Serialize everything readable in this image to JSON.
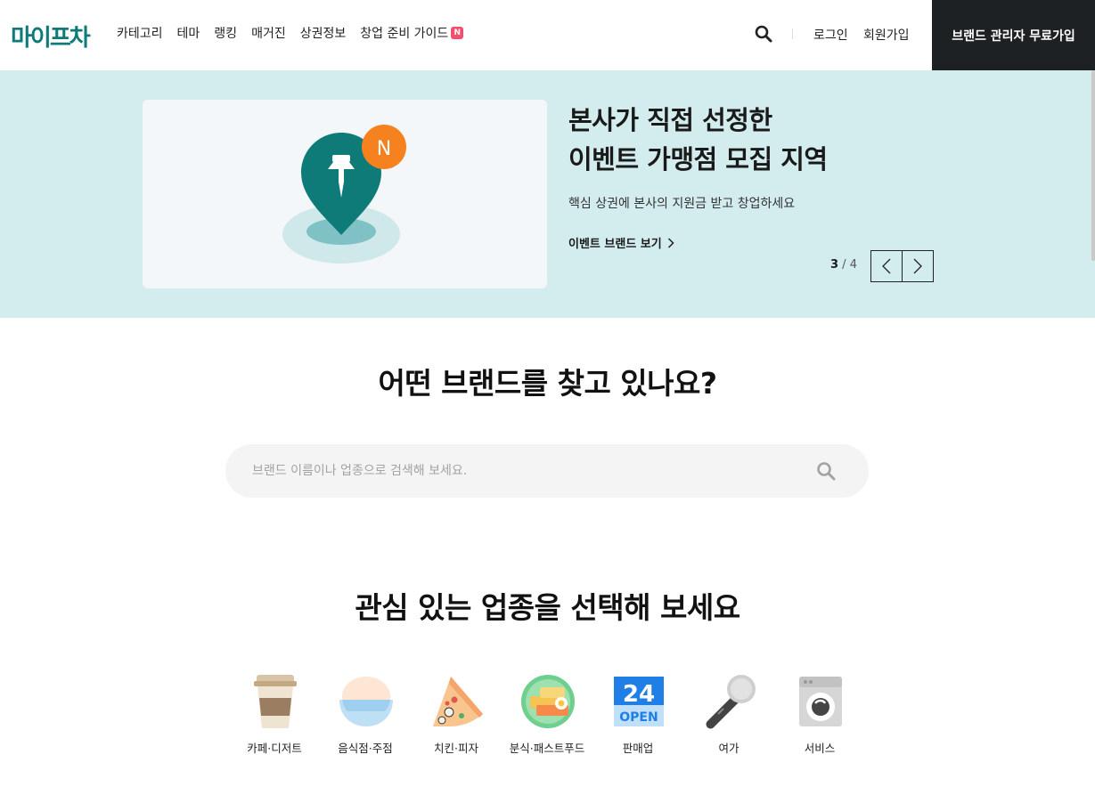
{
  "header": {
    "logo": "마이프차",
    "nav": [
      {
        "label": "카테고리"
      },
      {
        "label": "테마"
      },
      {
        "label": "랭킹"
      },
      {
        "label": "매거진"
      },
      {
        "label": "상권정보"
      },
      {
        "label": "창업 준비 가이드",
        "badge": "N"
      }
    ],
    "login": "로그인",
    "signup": "회원가입",
    "brand_join": "브랜드 관리자 무료가입"
  },
  "banner": {
    "badge": "N",
    "title_line1": "본사가 직접 선정한",
    "title_line2": "이벤트 가맹점 모집 지역",
    "subtitle": "핵심 상권에 본사의 지원금 받고 창업하세요",
    "link": "이벤트 브랜드 보기",
    "page_current": "3",
    "page_sep": " / ",
    "page_total": "4"
  },
  "search": {
    "title": "어떤 브랜드를 찾고 있나요?",
    "placeholder": "브랜드 이름이나 업종으로 검색해 보세요."
  },
  "categories": {
    "title": "관심 있는 업종을 선택해 보세요",
    "items": [
      {
        "label": "카페·디저트",
        "icon": "coffee-cup-icon"
      },
      {
        "label": "음식점·주점",
        "icon": "rice-bowl-icon"
      },
      {
        "label": "치킨·피자",
        "icon": "pizza-slice-icon"
      },
      {
        "label": "분식·패스트푸드",
        "icon": "snack-plate-icon"
      },
      {
        "label": "판매업",
        "icon": "24-open-icon"
      },
      {
        "label": "여가",
        "icon": "microphone-icon"
      },
      {
        "label": "서비스",
        "icon": "washing-machine-icon"
      }
    ],
    "icon_text_24": "24",
    "icon_text_open": "OPEN"
  },
  "colors": {
    "brand": "#0e7b78",
    "banner_bg": "#d3ecee",
    "badge_orange": "#f5811f",
    "dark_button": "#1e2124"
  }
}
